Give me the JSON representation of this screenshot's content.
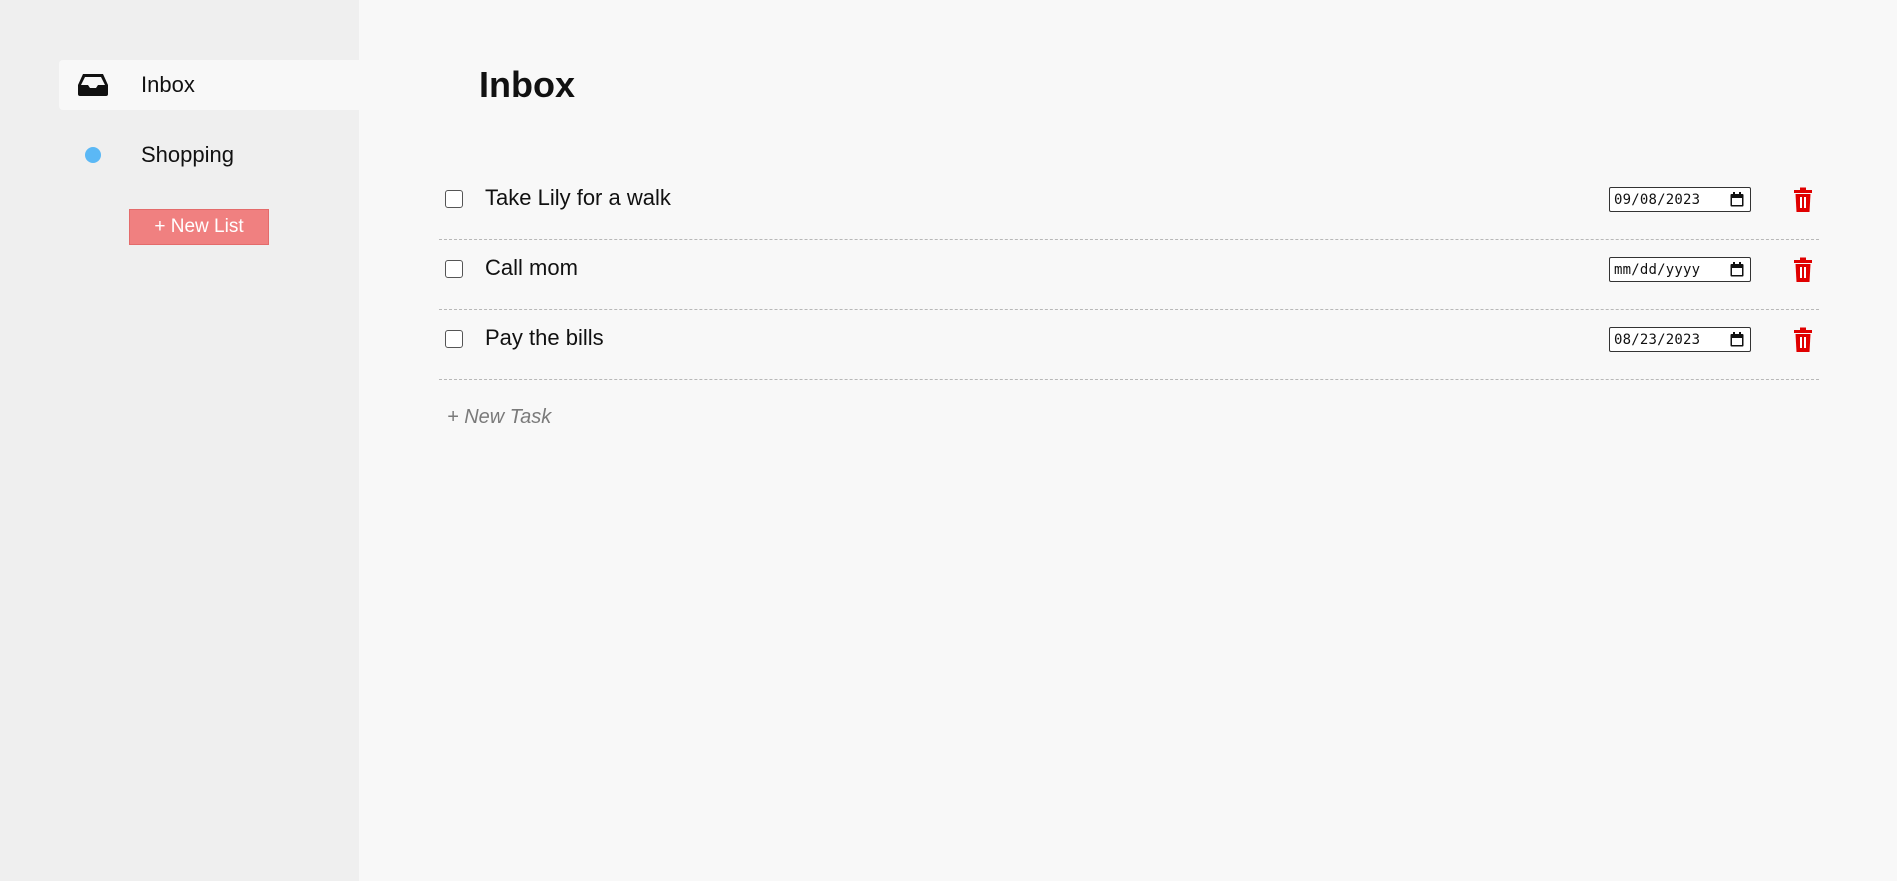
{
  "sidebar": {
    "items": [
      {
        "label": "Inbox",
        "icon": "inbox-icon",
        "active": true
      },
      {
        "label": "Shopping",
        "icon": "dot-icon",
        "color": "#5bb8f5",
        "active": false
      }
    ],
    "new_list_label": "+ New List",
    "new_list_color": "#f08080"
  },
  "main": {
    "title": "Inbox",
    "tasks": [
      {
        "title": "Take Lily for a walk",
        "date": "09/08/2023",
        "checked": false
      },
      {
        "title": "Call mom",
        "date": "mm/dd/yyyy",
        "checked": false
      },
      {
        "title": "Pay the bills",
        "date": "08/23/2023",
        "checked": false
      }
    ],
    "new_task_label": "+ New Task",
    "delete_color": "#e00000"
  }
}
